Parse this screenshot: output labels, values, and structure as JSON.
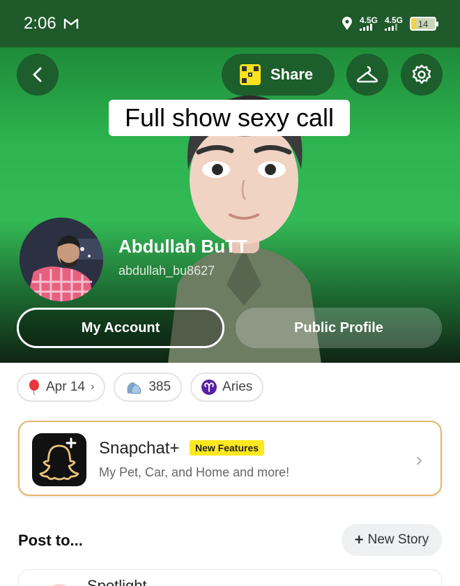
{
  "status_bar": {
    "time": "2:06",
    "mail_icon": "gmail-icon",
    "network1": "4.5G",
    "network2": "4.5G",
    "battery": "14"
  },
  "header": {
    "share_label": "Share",
    "icons": [
      "back-chevron-icon",
      "qr-code-icon",
      "hanger-icon",
      "gear-icon"
    ]
  },
  "overlay_caption": "Full show sexy call",
  "profile": {
    "name": "Abdullah BuTT",
    "username": "abdullah_bu8627"
  },
  "buttons": {
    "my_account": "My Account",
    "public_profile": "Public Profile"
  },
  "chips": {
    "birthday": "Apr 14",
    "friends_count": "385",
    "zodiac": "Aries"
  },
  "snapchat_plus": {
    "title": "Snapchat+",
    "badge": "New Features",
    "subtitle": "My Pet, Car, and Home and more!"
  },
  "post_to": {
    "heading": "Post to...",
    "new_story": "New Story",
    "first_option": "Spotlight"
  },
  "colors": {
    "hero_green": "#2db34f",
    "button_green": "#1c5e2c",
    "badge_yellow": "#ffe81f",
    "plus_border": "#e6b46a"
  }
}
